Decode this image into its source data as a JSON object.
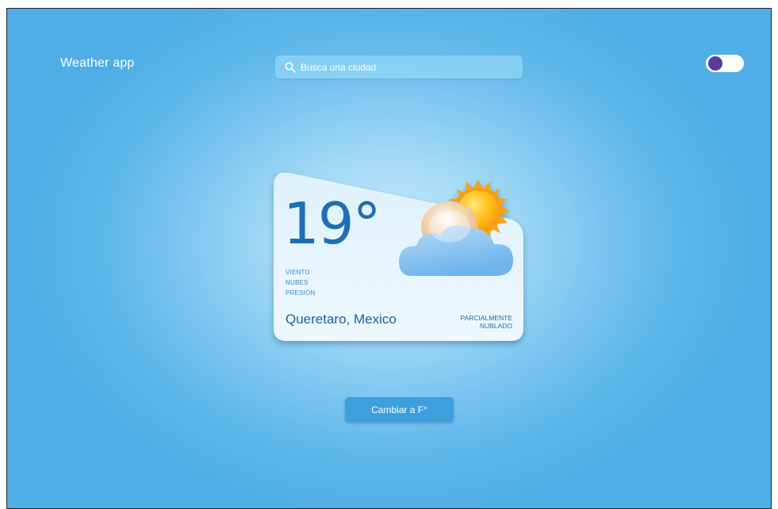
{
  "header": {
    "app_title": "Weather app",
    "search": {
      "placeholder": "Busca una ciudad",
      "value": ""
    },
    "theme_toggle": {
      "state": "off"
    }
  },
  "weather": {
    "temperature": "19°",
    "details": [
      "VIENTO",
      "NUBES",
      "PRESIÓN"
    ],
    "city": "Queretaro, Mexico",
    "condition_line1": "PARCIALMENTE",
    "condition_line2": "NUBLADO",
    "icon": "partly-cloudy-icon"
  },
  "actions": {
    "convert_button": "Cambiar a F°"
  },
  "colors": {
    "background_outer": "#4faee6",
    "background_center": "#c9ecfb",
    "card": "#e8f5fd",
    "accent_text": "#1e6fb5",
    "button": "#3d9fdc",
    "toggle_knob": "#5a3a9a"
  }
}
